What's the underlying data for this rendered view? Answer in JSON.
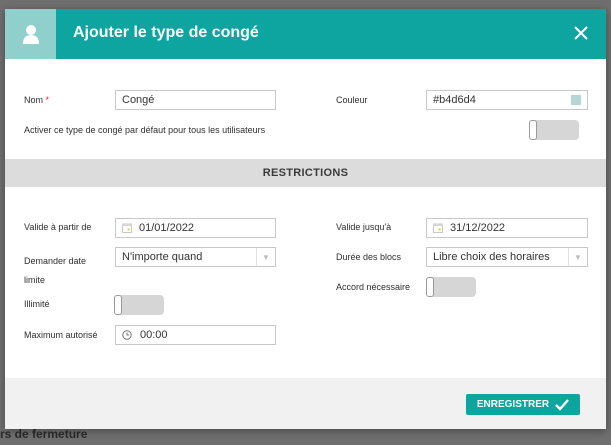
{
  "background": {
    "bottom_text": "rs de fermeture"
  },
  "modal": {
    "title": "Ajouter le type de congé",
    "header_color": "#0ea5a0",
    "avatar_color": "#8fd0cc",
    "top": {
      "name_label": "Nom",
      "name_required_marker": "*",
      "name_value": "Congé",
      "color_label": "Couleur",
      "color_value": "#b4d6d4",
      "default_label": "Activer ce type de congé par défaut pour tous les utilisateurs",
      "default_toggle_on": false
    },
    "section_title": "RESTRICTIONS",
    "restrictions": {
      "start_label": "Valide à partir de",
      "start_value": "01/01/2022",
      "end_label": "Valide jusqu'à",
      "end_value": "31/12/2022",
      "deadline_label_line1": "Demander date",
      "deadline_label_line2": "limite",
      "deadline_value": "N'importe quand",
      "block_label": "Durée des blocs",
      "block_value": "Libre choix des horaires",
      "agreement_label": "Accord nécessaire",
      "agreement_toggle_on": false,
      "unlimited_label": "Illimité",
      "unlimited_toggle_on": false,
      "max_label": "Maximum autorisé",
      "max_value": "00:00"
    },
    "footer": {
      "save_label": "ENREGISTRER"
    }
  }
}
